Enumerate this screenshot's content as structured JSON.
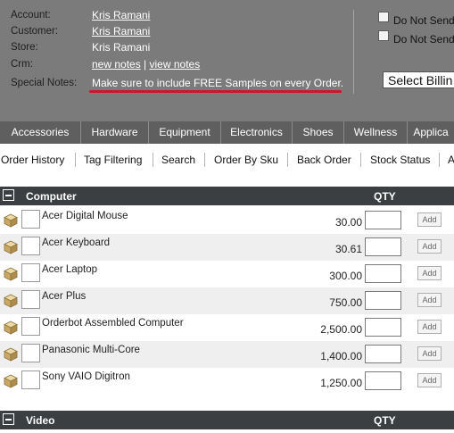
{
  "customer_info": {
    "account_label": "Account:",
    "account_value": "Kris Ramani",
    "customer_label": "Customer:",
    "customer_value": "Kris Ramani",
    "store_label": "Store:",
    "store_value": "Kris Ramani",
    "crm_label": "Crm:",
    "crm_new_notes": "new notes",
    "crm_separator": "|",
    "crm_view_notes": "view notes",
    "special_notes_label": "Special Notes:",
    "special_notes_value": "Make sure to include FREE Samples on every Order."
  },
  "options": {
    "do_not_send_1": "Do Not Send",
    "do_not_send_2": "Do Not Send",
    "select_billing": "Select Billin"
  },
  "category_tabs": [
    "Accessories",
    "Hardware",
    "Equipment",
    "Electronics",
    "Shoes",
    "Wellness",
    "Applica"
  ],
  "nav_links": [
    "Order History",
    "Tag Filtering",
    "Search",
    "Order By Sku",
    "Back Order",
    "Stock Status",
    "A"
  ],
  "sections": [
    {
      "title": "Computer",
      "qty_label": "QTY",
      "add_label": "Add",
      "products": [
        {
          "name": "Acer Digital Mouse",
          "price": "30.00"
        },
        {
          "name": "Acer Keyboard",
          "price": "30.61"
        },
        {
          "name": "Acer Laptop",
          "price": "300.00"
        },
        {
          "name": "Acer Plus",
          "price": "750.00"
        },
        {
          "name": "Orderbot Assembled Computer",
          "price": "2,500.00"
        },
        {
          "name": "Panasonic Multi-Core",
          "price": "1,400.00"
        },
        {
          "name": "Sony VAIO Digitron",
          "price": "1,250.00"
        }
      ]
    },
    {
      "title": "Video",
      "qty_label": "QTY"
    }
  ],
  "colors": {
    "header_bg": "#7b7b7b",
    "tabs_bg": "#5f5f5f",
    "section_header_bg": "#3b3f41",
    "highlight_underline": "#d0142a"
  },
  "icons": {
    "product_icon": "package-box-icon",
    "collapse_icon": "minus-square-icon"
  }
}
